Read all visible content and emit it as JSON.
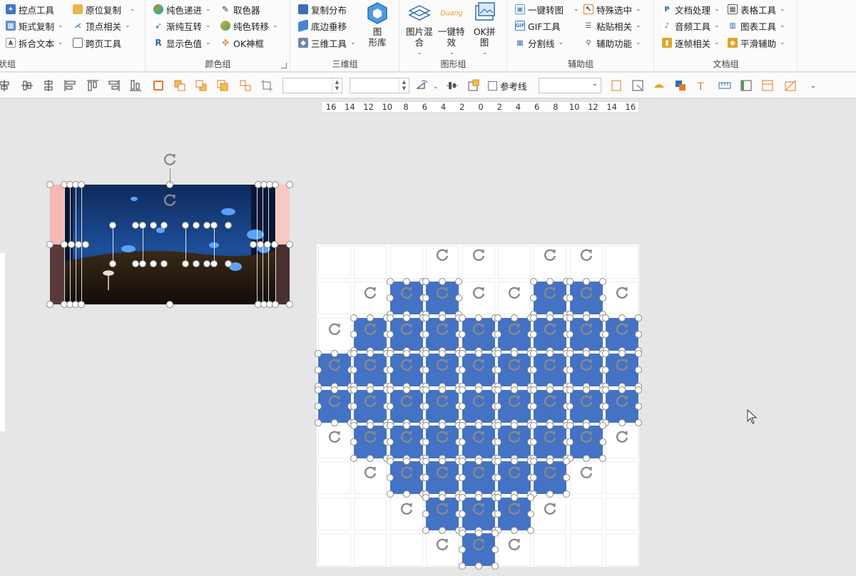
{
  "ribbon": {
    "groups": {
      "shape": {
        "label": "状组",
        "items": [
          {
            "label": "控点工具",
            "icon": "control-point-icon"
          },
          {
            "label": "矩式复制",
            "icon": "matrix-copy-icon"
          },
          {
            "label": "拆合文本",
            "icon": "split-text-icon"
          },
          {
            "label": "原位复制",
            "icon": "in-place-copy-icon"
          },
          {
            "label": "顶点相关",
            "icon": "vertex-icon"
          },
          {
            "label": "跨页工具",
            "icon": "cross-page-icon"
          }
        ]
      },
      "color": {
        "label": "颜色组",
        "items": [
          {
            "label": "纯色递进",
            "icon": "color-progression-icon"
          },
          {
            "label": "渐纯互转",
            "icon": "gradient-convert-icon"
          },
          {
            "label": "显示色值",
            "icon": "show-color-value-icon"
          },
          {
            "label": "取色器",
            "icon": "eyedropper-icon"
          },
          {
            "label": "纯色转移",
            "icon": "color-transfer-icon"
          },
          {
            "label": "OK神框",
            "icon": "ok-frame-icon"
          }
        ]
      },
      "threed": {
        "label": "三维组",
        "items": [
          {
            "label": "复制分布",
            "icon": "copy-distribute-icon"
          },
          {
            "label": "底边垂移",
            "icon": "bottom-shift-icon"
          },
          {
            "label": "三维工具",
            "icon": "3d-tools-icon"
          }
        ],
        "big": {
          "label": "图\n形库",
          "icon": "shape-library-icon"
        }
      },
      "graphic": {
        "label": "图形组",
        "big": [
          {
            "label": "图片混\n合",
            "icon": "image-blend-icon"
          },
          {
            "label": "一键特\n效",
            "icon": "duang-effect-icon",
            "badge": "Duang"
          },
          {
            "label": "OK拼\n图",
            "icon": "ok-puzzle-icon"
          }
        ]
      },
      "assist": {
        "label": "辅助组",
        "items": [
          {
            "label": "一键转图",
            "icon": "convert-image-icon"
          },
          {
            "label": "GIF工具",
            "icon": "gif-icon"
          },
          {
            "label": "分割线",
            "icon": "divider-grid-icon"
          },
          {
            "label": "特殊选中",
            "icon": "special-select-icon"
          },
          {
            "label": "粘贴相关",
            "icon": "paste-icon"
          },
          {
            "label": "辅助功能",
            "icon": "assist-icon"
          }
        ]
      },
      "doc": {
        "label": "文档组",
        "items": [
          {
            "label": "文档处理",
            "icon": "document-icon"
          },
          {
            "label": "音频工具",
            "icon": "audio-icon"
          },
          {
            "label": "逐帧相关",
            "icon": "frame-icon"
          },
          {
            "label": "表格工具",
            "icon": "table-icon"
          },
          {
            "label": "图表工具",
            "icon": "chart-icon"
          },
          {
            "label": "平滑辅助",
            "icon": "smooth-icon"
          }
        ]
      }
    }
  },
  "toolbar": {
    "guide_label": "参考线",
    "guide_checked": false,
    "width_value": "",
    "height_value": "",
    "select_value": ""
  },
  "ruler": {
    "ticks": [
      "16",
      "14",
      "12",
      "10",
      "8",
      "6",
      "4",
      "2",
      "0",
      "2",
      "4",
      "6",
      "8",
      "10",
      "12",
      "14",
      "16"
    ]
  },
  "colors": {
    "accent": "#4472c4",
    "ribbon_bg": "#fbfbfb",
    "canvas_bg": "#e6e6e6"
  },
  "heart_grid": {
    "rows": [
      "000000000",
      "001100110",
      "011111111",
      "111111111",
      "111111111",
      "011111110",
      "001111100",
      "000111000",
      "000010000"
    ]
  }
}
